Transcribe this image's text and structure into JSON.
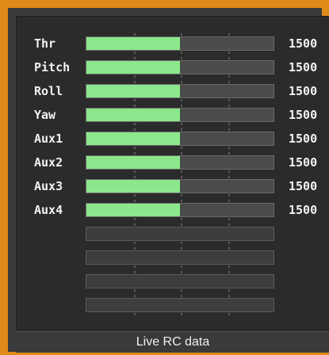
{
  "panel": {
    "title": "Live RC data",
    "accent_color": "#e08a1a",
    "bar_fill_color": "#8be78b"
  },
  "channels": [
    {
      "label": "Thr",
      "value": "1500",
      "fill_fraction": 0.5
    },
    {
      "label": "Pitch",
      "value": "1500",
      "fill_fraction": 0.5
    },
    {
      "label": "Roll",
      "value": "1500",
      "fill_fraction": 0.5
    },
    {
      "label": "Yaw",
      "value": "1500",
      "fill_fraction": 0.5
    },
    {
      "label": "Aux1",
      "value": "1500",
      "fill_fraction": 0.5
    },
    {
      "label": "Aux2",
      "value": "1500",
      "fill_fraction": 0.5
    },
    {
      "label": "Aux3",
      "value": "1500",
      "fill_fraction": 0.5
    },
    {
      "label": "Aux4",
      "value": "1500",
      "fill_fraction": 0.5
    },
    {
      "label": "",
      "value": "",
      "fill_fraction": 0
    },
    {
      "label": "",
      "value": "",
      "fill_fraction": 0
    },
    {
      "label": "",
      "value": "",
      "fill_fraction": 0
    },
    {
      "label": "",
      "value": "",
      "fill_fraction": 0
    }
  ]
}
